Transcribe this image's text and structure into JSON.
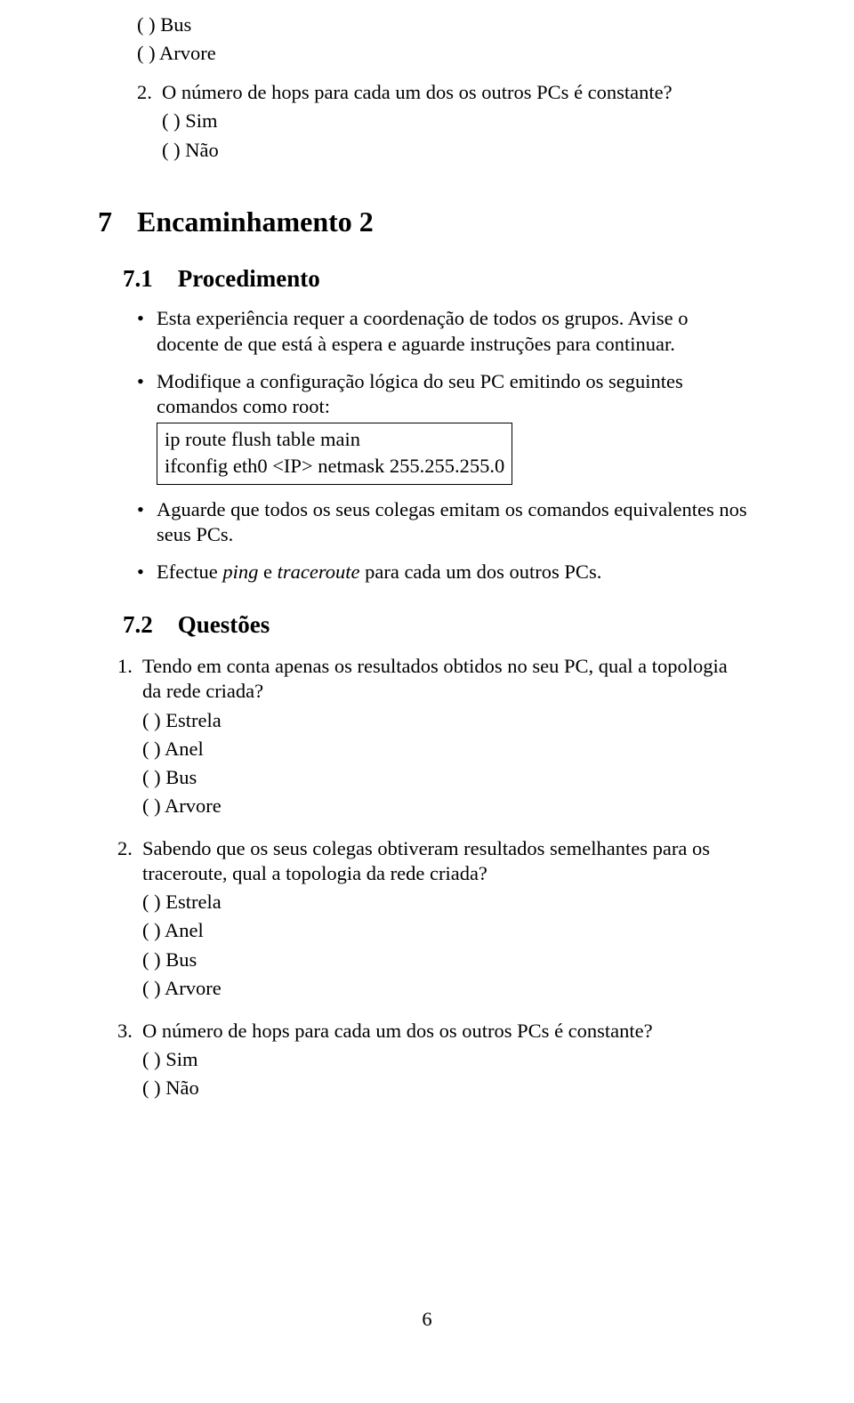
{
  "top_options": {
    "bus": "( ) Bus",
    "arvore": "( ) Arvore"
  },
  "top_q2": {
    "num": "2.",
    "text": "O número de hops para cada um dos os outros PCs é constante?",
    "sim": "( ) Sim",
    "nao": "( ) Não"
  },
  "sec7": {
    "num": "7",
    "title": "Encaminhamento 2"
  },
  "sec71": {
    "num": "7.1",
    "title": "Procedimento"
  },
  "proc": {
    "b1": "Esta experiência requer a coordenação de todos os grupos. Avise o docente de que está à espera e aguarde instruções para continuar.",
    "b2": "Modifique a configuração lógica do seu PC emitindo os seguintes comandos como root:",
    "cmd1": "ip route flush table main",
    "cmd2": "ifconfig eth0 <IP> netmask 255.255.255.0",
    "b3": "Aguarde que todos os seus colegas emitam os comandos equivalentes nos seus PCs.",
    "b4_before": "Efectue ",
    "b4_ping": "ping",
    "b4_mid": " e ",
    "b4_trace": "traceroute",
    "b4_after": " para cada um dos outros PCs."
  },
  "sec72": {
    "num": "7.2",
    "title": "Questões"
  },
  "q": {
    "q1": {
      "num": "1.",
      "text": "Tendo em conta apenas os resultados obtidos no seu PC, qual a topologia da rede criada?",
      "estrela": "( ) Estrela",
      "anel": "( ) Anel",
      "bus": "( ) Bus",
      "arvore": "( ) Arvore"
    },
    "q2": {
      "num": "2.",
      "text": "Sabendo que os seus colegas obtiveram resultados semelhantes para os traceroute, qual a topologia da rede criada?",
      "estrela": "( ) Estrela",
      "anel": "( ) Anel",
      "bus": "( ) Bus",
      "arvore": "( ) Arvore"
    },
    "q3": {
      "num": "3.",
      "text": "O número de hops para cada um dos os outros PCs é constante?",
      "sim": "( ) Sim",
      "nao": "( ) Não"
    }
  },
  "page_number": "6"
}
